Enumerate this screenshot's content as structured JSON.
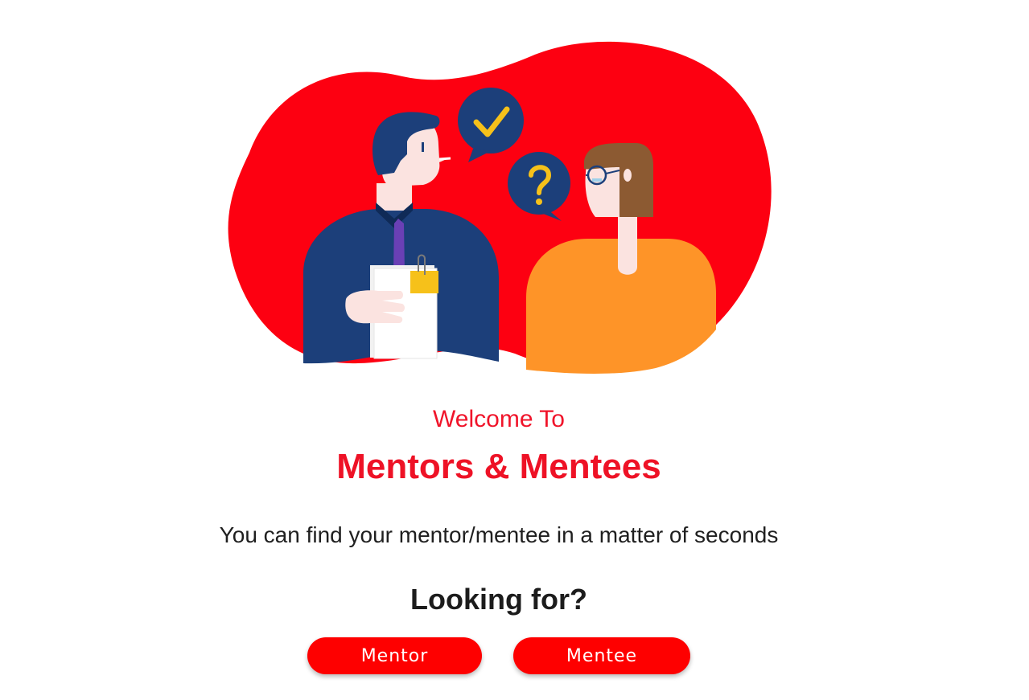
{
  "colors": {
    "accent": "#fe0000",
    "blob": "#fd0011",
    "heading_red": "#ee1226",
    "text": "#1f1f1f",
    "man_shirt": "#1c3f7a",
    "woman_shirt": "#fe9428",
    "bubble": "#1c3f7a",
    "bubble_symbol": "#f6c11a"
  },
  "hero": {
    "illustration_icons": [
      "checkmark-bubble-icon",
      "question-bubble-icon"
    ]
  },
  "welcome": {
    "intro": "Welcome To",
    "title": "Mentors & Mentees",
    "subtitle": "You can find your mentor/mentee in a matter of seconds",
    "question": "Looking for?"
  },
  "actions": {
    "mentor_label": "Mentor",
    "mentee_label": "Mentee"
  }
}
